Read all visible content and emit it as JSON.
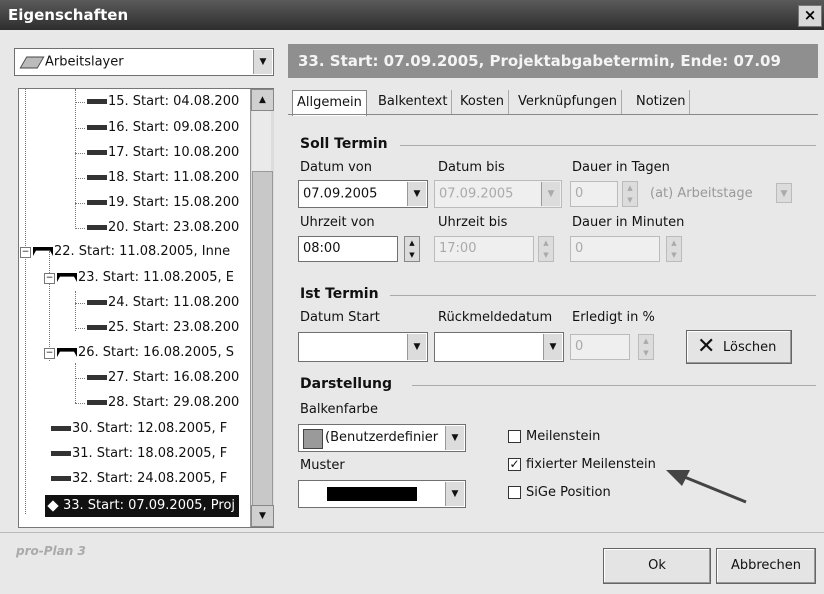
{
  "window": {
    "title": "Eigenschaften",
    "close": "×"
  },
  "layer": {
    "value": "Arbeitslayer"
  },
  "header": {
    "text": "33. Start: 07.09.2005, Projektabgabetermin, Ende: 07.09"
  },
  "tree": {
    "items": [
      {
        "label": "15. Start: 04.08.200"
      },
      {
        "label": "16. Start: 09.08.200"
      },
      {
        "label": "17. Start: 10.08.200"
      },
      {
        "label": "18. Start: 11.08.200"
      },
      {
        "label": "19. Start: 15.08.200"
      },
      {
        "label": "20. Start: 23.08.200"
      },
      {
        "label": "22. Start: 11.08.2005, Inne"
      },
      {
        "label": "23. Start: 11.08.2005, E"
      },
      {
        "label": "24. Start: 11.08.200"
      },
      {
        "label": "25. Start: 23.08.200"
      },
      {
        "label": "26. Start: 16.08.2005, S"
      },
      {
        "label": "27. Start: 16.08.200"
      },
      {
        "label": "28. Start: 29.08.200"
      },
      {
        "label": "30. Start: 12.08.2005, F"
      },
      {
        "label": "31. Start: 18.08.2005, F"
      },
      {
        "label": "32. Start: 24.08.2005, F"
      },
      {
        "label": "33. Start: 07.09.2005, Proj"
      }
    ]
  },
  "tabs": [
    "Allgemein",
    "Balkentext",
    "Kosten",
    "Verknüpfungen",
    "Notizen"
  ],
  "soll": {
    "title": "Soll Termin",
    "datum_von_label": "Datum von",
    "datum_bis_label": "Datum bis",
    "dauer_tage_label": "Dauer in Tagen",
    "datum_von": "07.09.2005",
    "datum_bis": "07.09.2005",
    "dauer_tage": "0",
    "arbeitstage": "(at) Arbeitstage",
    "uhrzeit_von_label": "Uhrzeit von",
    "uhrzeit_bis_label": "Uhrzeit bis",
    "dauer_min_label": "Dauer in Minuten",
    "uhrzeit_von": "08:00",
    "uhrzeit_bis": "17:00",
    "dauer_min": "0"
  },
  "ist": {
    "title": "Ist Termin",
    "datum_start_label": "Datum Start",
    "rueckmelde_label": "Rückmeldedatum",
    "erledigt_label": "Erledigt in %",
    "erledigt": "0",
    "loeschen": "Löschen"
  },
  "darstellung": {
    "title": "Darstellung",
    "balkenfarbe_label": "Balkenfarbe",
    "balkenfarbe": "(Benutzerdefinier",
    "muster_label": "Muster",
    "meilenstein": "Meilenstein",
    "fixierter": "fixierter Meilenstein",
    "sige": "SiGe Position",
    "meilenstein_checked": false,
    "fixierter_checked": true,
    "sige_checked": false
  },
  "footer": {
    "brand": "pro-Plan 3",
    "ok": "Ok",
    "abbrechen": "Abbrechen"
  }
}
